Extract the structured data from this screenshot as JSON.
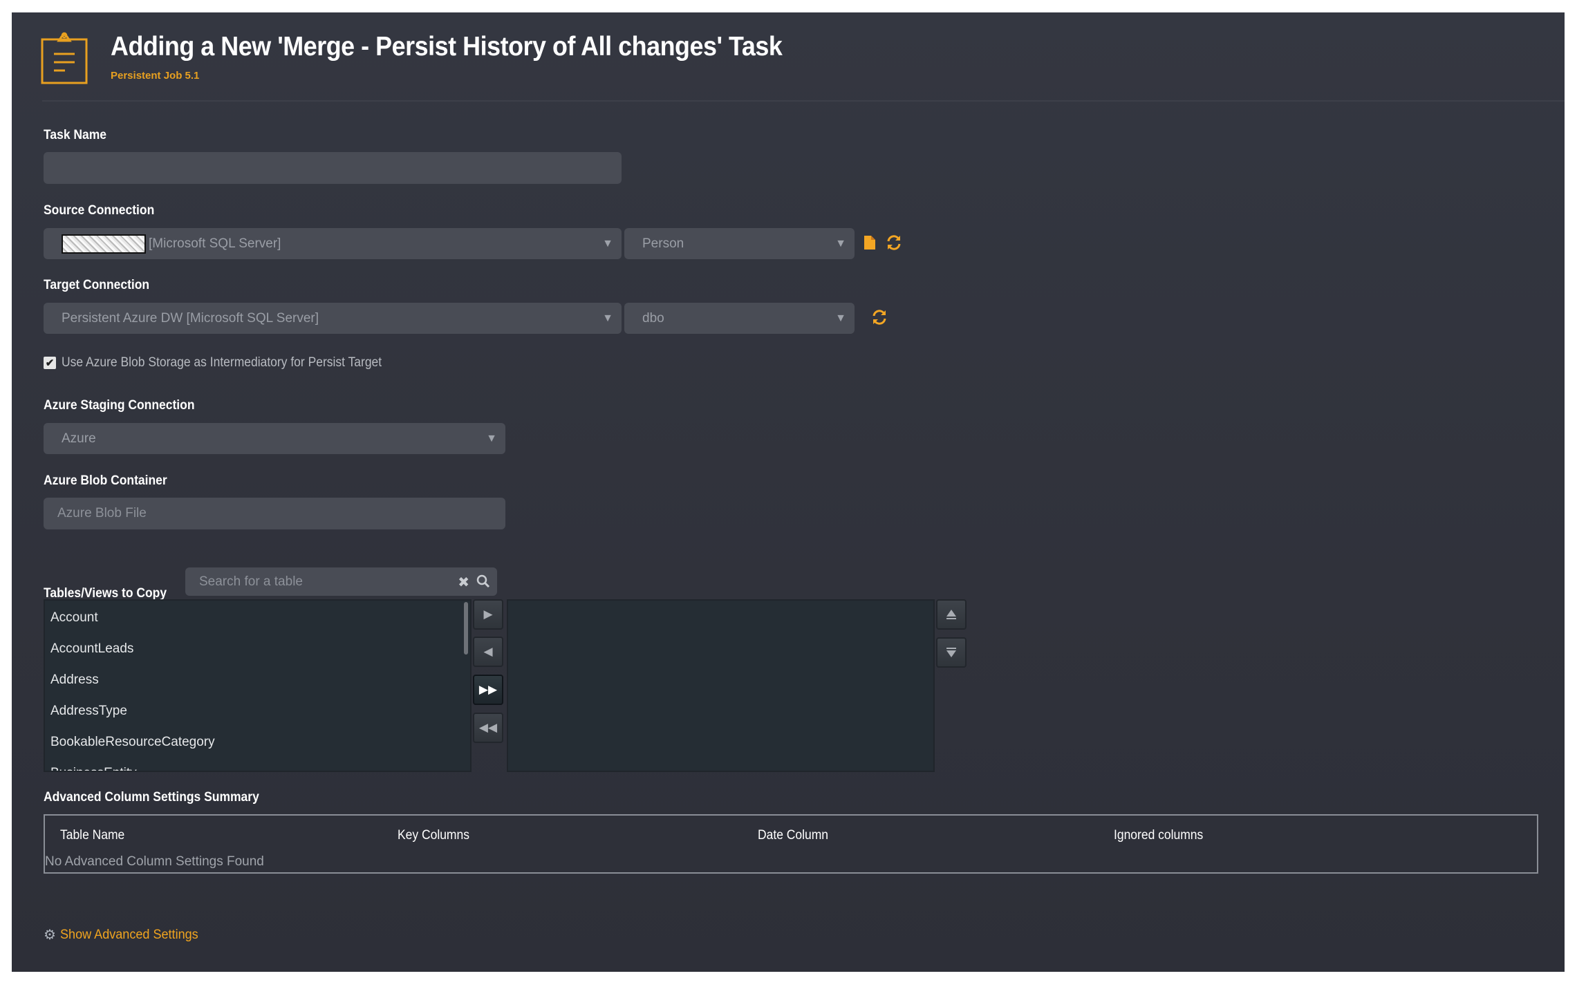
{
  "header": {
    "icon": "clipboard-icon",
    "title": "Adding a New 'Merge - Persist History of All changes' Task",
    "subtitle": "Persistent Job 5.1"
  },
  "task_name": {
    "label": "Task Name",
    "value": ""
  },
  "source_connection": {
    "label": "Source Connection",
    "connection_redacted": true,
    "connection_value": "[Microsoft SQL Server]",
    "schema_value": "Person",
    "icons": [
      "file-icon",
      "refresh-icon"
    ]
  },
  "target_connection": {
    "label": "Target Connection",
    "connection_value": "Persistent Azure DW [Microsoft SQL Server]",
    "schema_value": "dbo",
    "icons": [
      "refresh-icon"
    ]
  },
  "use_blob_checkbox": {
    "label": "Use Azure Blob Storage as Intermediatory for Persist Target",
    "checked": true
  },
  "azure_staging": {
    "label": "Azure Staging Connection",
    "value": "Azure"
  },
  "azure_blob": {
    "label": "Azure Blob Container",
    "placeholder": "Azure Blob File"
  },
  "tables": {
    "label": "Tables/Views to Copy",
    "search_placeholder": "Search for a table",
    "available": [
      "Account",
      "AccountLeads",
      "Address",
      "AddressType",
      "BookableResourceCategory",
      "BusinessEntity"
    ],
    "selected": [],
    "move_buttons": [
      "move-right",
      "move-left",
      "move-all-right",
      "move-all-left"
    ],
    "order_buttons": [
      "move-up",
      "move-down"
    ]
  },
  "advanced_summary": {
    "label": "Advanced Column Settings Summary",
    "columns": [
      "Table Name",
      "Key Columns",
      "Date Column",
      "Ignored columns"
    ],
    "empty_message": "No Advanced Column Settings Found"
  },
  "advanced_link": {
    "label": "Show Advanced Settings"
  },
  "colors": {
    "accent": "#f0a41f",
    "panel_bg": "#31333c",
    "field_bg": "#494c55",
    "list_bg": "#252d34"
  }
}
